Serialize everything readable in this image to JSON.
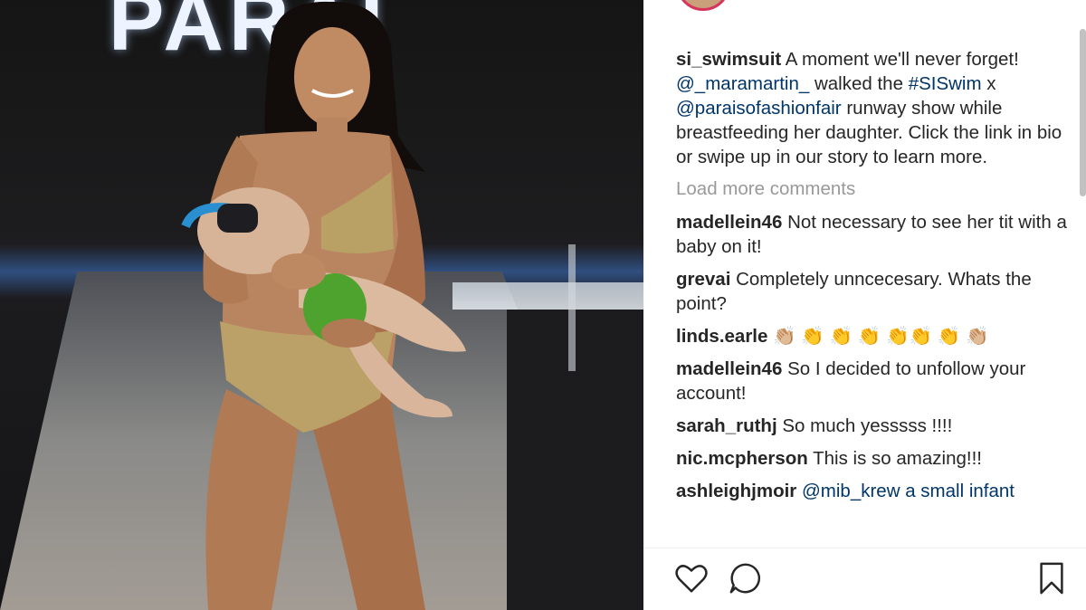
{
  "photo": {
    "sign_text": "PARAI"
  },
  "post": {
    "caption": {
      "user": "si_swimsuit",
      "text_before": " A moment we'll never forget! ",
      "mention1": "@_maramartin_",
      "text_mid1": " walked the ",
      "hashtag": "#SISwim",
      "text_mid2": " x ",
      "mention2": "@paraisofashionfair",
      "text_after": " runway show while breastfeeding her daughter. Click the link in bio or swipe up in our story to learn more."
    },
    "load_more_label": "Load more comments",
    "comments": [
      {
        "user": "madellein46",
        "text": " Not necessary to see her tit with a baby on it!"
      },
      {
        "user": "grevai",
        "text": " Completely unncecesary. Whats the point?"
      },
      {
        "user": "linds.earle",
        "text": " 👏🏼 👏 👏 👏 👏👏 👏 👏🏼"
      },
      {
        "user": "madellein46",
        "text": " So I decided to unfollow your account!"
      },
      {
        "user": "sarah_ruthj",
        "text": " So much yesssss !!!!"
      },
      {
        "user": "nic.mcpherson",
        "text": " This is so amazing!!!"
      },
      {
        "user": "ashleighjmoir",
        "text": " @mib_krew a small infant"
      }
    ]
  },
  "icons": {
    "like": "heart-icon",
    "comment": "comment-bubble-icon",
    "save": "bookmark-icon"
  },
  "colors": {
    "link": "#003569",
    "muted": "#999999",
    "text": "#262626",
    "avatar_ring": "#d6335d"
  }
}
